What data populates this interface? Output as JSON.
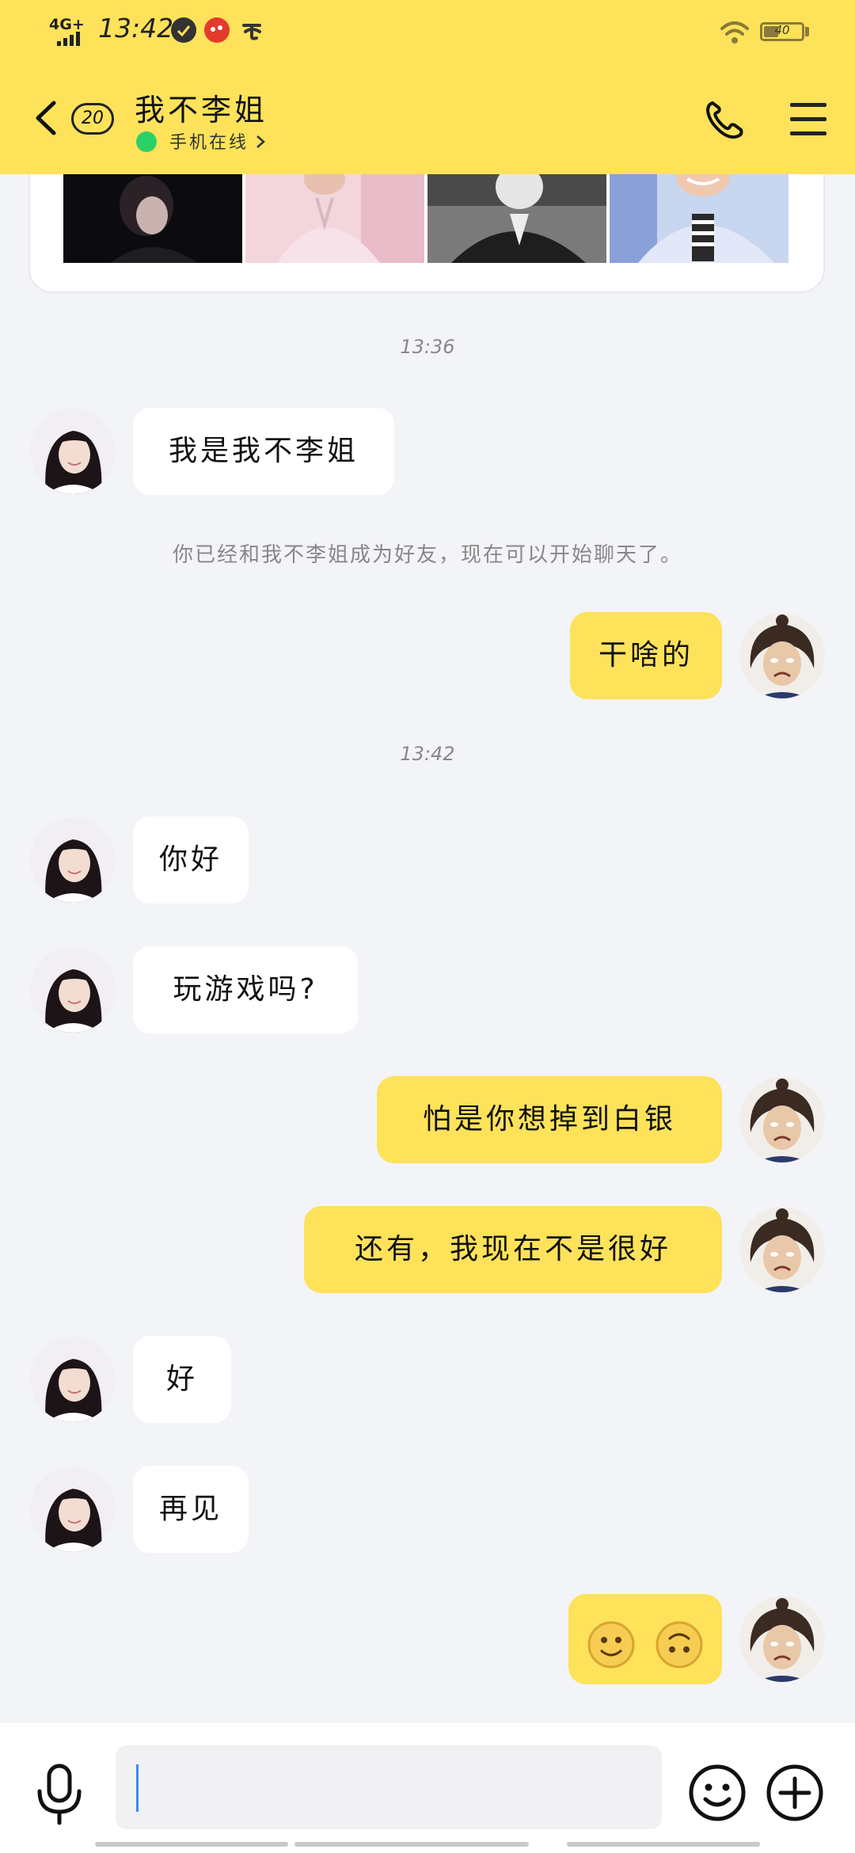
{
  "status_bar": {
    "network": "4G+",
    "time": "13:42",
    "battery": "40",
    "battery_fraction": 0.4
  },
  "header": {
    "unread_count": "20",
    "contact_name": "我不李姐",
    "online_status": "手机在线"
  },
  "chat": {
    "timestamps": [
      "13:36",
      "13:42"
    ],
    "system_note": "你已经和我不李姐成为好友，现在可以开始聊天了。",
    "messages": [
      {
        "from": "contact",
        "text": "我是我不李姐"
      },
      {
        "from": "me",
        "text": "干啥的"
      },
      {
        "from": "contact",
        "text": "你好"
      },
      {
        "from": "contact",
        "text": "玩游戏吗?"
      },
      {
        "from": "me",
        "text": "怕是你想掉到白银"
      },
      {
        "from": "me",
        "text": "还有，我现在不是很好"
      },
      {
        "from": "contact",
        "text": "好"
      },
      {
        "from": "contact",
        "text": "再见"
      },
      {
        "from": "me",
        "emojis": [
          "smiley-emoji",
          "upside-down-smiley-emoji"
        ]
      }
    ]
  },
  "input": {
    "value": "",
    "placeholder": ""
  },
  "colors": {
    "accent": "#fde25a",
    "background": "#f3f4f8",
    "online": "#2bd167",
    "caret": "#3b8bf5"
  },
  "icons": [
    "back-arrow-icon",
    "phone-icon",
    "menu-icon",
    "mic-icon",
    "emoji-icon",
    "plus-icon"
  ]
}
